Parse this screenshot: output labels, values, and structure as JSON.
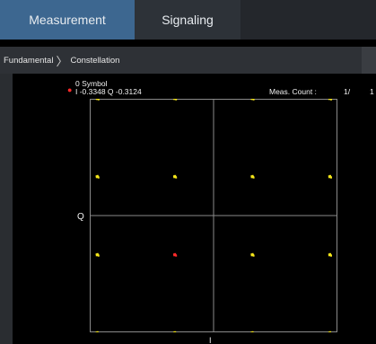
{
  "tabs": [
    {
      "label": "Measurement",
      "active": true
    },
    {
      "label": "Signaling",
      "active": false
    }
  ],
  "breadcrumb": {
    "items": [
      "Fundamental",
      "Constellation"
    ],
    "separator": "〉"
  },
  "marker": {
    "symbol_text": "0 Symbol",
    "iq_text": "I -0.3348 Q -0.3124",
    "color": "#ff2a2a"
  },
  "measurement": {
    "count_label": "Meas. Count :",
    "count_value": "1/",
    "count_value_2": "1"
  },
  "axes": {
    "q_label": "Q",
    "i_label": "I",
    "grid_color": "#8a8a8a"
  },
  "constellation": {
    "modulation": "16QAM",
    "point_color": "#f5e61a",
    "marker_index": 9,
    "points": [
      {
        "i": -0.9,
        "q": 0.9
      },
      {
        "i": -0.3,
        "q": 0.9
      },
      {
        "i": 0.3,
        "q": 0.9
      },
      {
        "i": 0.9,
        "q": 0.9
      },
      {
        "i": -0.9,
        "q": 0.3
      },
      {
        "i": -0.3,
        "q": 0.3
      },
      {
        "i": 0.3,
        "q": 0.3
      },
      {
        "i": 0.9,
        "q": 0.3
      },
      {
        "i": -0.9,
        "q": -0.3
      },
      {
        "i": -0.3,
        "q": -0.3
      },
      {
        "i": 0.3,
        "q": -0.3
      },
      {
        "i": 0.9,
        "q": -0.3
      },
      {
        "i": -0.9,
        "q": -0.9
      },
      {
        "i": -0.3,
        "q": -0.9
      },
      {
        "i": 0.3,
        "q": -0.9
      },
      {
        "i": 0.9,
        "q": -0.9
      }
    ]
  }
}
